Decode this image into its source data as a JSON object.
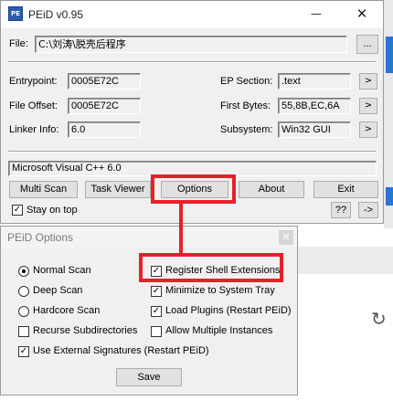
{
  "main_window": {
    "title": "PEiD v0.95",
    "icon_text": "PE",
    "minimize_glyph": "—",
    "close_glyph": "✕",
    "file_label": "File:",
    "file_path": "C:\\刘涛\\脱壳后程序",
    "browse_label": "...",
    "fields": {
      "entrypoint_label": "Entrypoint:",
      "entrypoint_value": "0005E72C",
      "file_offset_label": "File Offset:",
      "file_offset_value": "0005E72C",
      "linker_info_label": "Linker Info:",
      "linker_info_value": "6.0",
      "ep_section_label": "EP Section:",
      "ep_section_value": ".text",
      "first_bytes_label": "First Bytes:",
      "first_bytes_value": "55,8B,EC,6A",
      "subsystem_label": "Subsystem:",
      "subsystem_value": "Win32 GUI",
      "arrow_label": ">"
    },
    "detection_result": "Microsoft Visual C++ 6.0",
    "buttons": {
      "multi_scan": "Multi Scan",
      "task_viewer": "Task Viewer",
      "options": "Options",
      "about": "About",
      "exit": "Exit",
      "help": "??",
      "extra": "->"
    },
    "stay_on_top_label": "Stay on top",
    "stay_on_top_checked": true
  },
  "options_dialog": {
    "title": "PEiD Options",
    "close_glyph": "✕",
    "scan_modes": [
      {
        "label": "Normal Scan",
        "selected": true
      },
      {
        "label": "Deep Scan",
        "selected": false
      },
      {
        "label": "Hardcore Scan",
        "selected": false
      }
    ],
    "options": {
      "recurse_subdirectories": {
        "label": "Recurse Subdirectories",
        "checked": false
      },
      "use_external_signatures": {
        "label": "Use External Signatures (Restart PEiD)",
        "checked": true
      },
      "register_shell_extensions": {
        "label": "Register Shell Extensions",
        "checked": true
      },
      "minimize_to_system_tray": {
        "label": "Minimize to System Tray",
        "checked": true
      },
      "load_plugins": {
        "label": "Load Plugins (Restart PEiD)",
        "checked": true
      },
      "allow_multiple_instances": {
        "label": "Allow Multiple Instances",
        "checked": false
      }
    },
    "save_label": "Save"
  },
  "colors": {
    "highlight": "#e8202a",
    "window_bg": "#f0f0f0",
    "background_accent": "#2b73d4"
  },
  "icons": {
    "check_glyph": "✓",
    "refresh_glyph": "↻"
  }
}
